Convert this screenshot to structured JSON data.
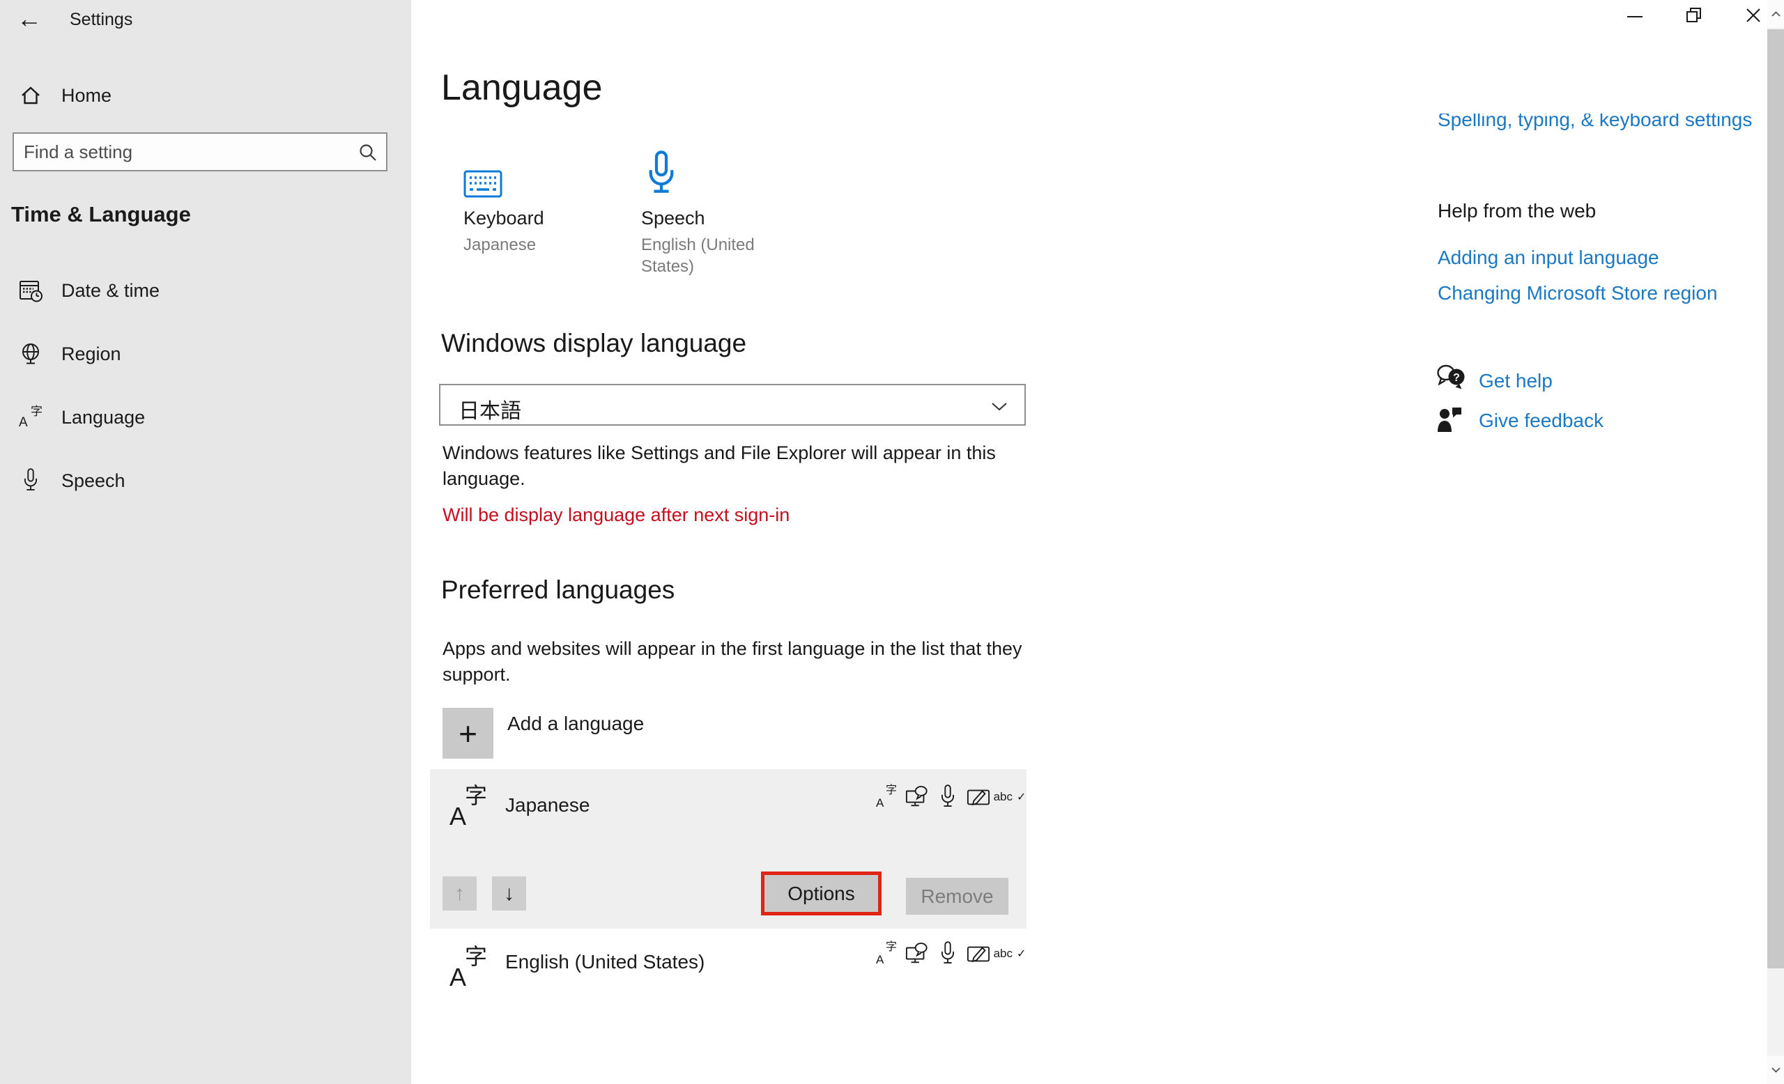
{
  "window": {
    "title": "Settings"
  },
  "titlebar": {
    "back_icon": "←"
  },
  "sidebar": {
    "home_label": "Home",
    "search": {
      "placeholder": "Find a setting"
    },
    "section_label": "Time & Language",
    "items": [
      {
        "label": "Date & time",
        "icon": "calendar-clock-icon"
      },
      {
        "label": "Region",
        "icon": "globe-icon"
      },
      {
        "label": "Language",
        "icon": "language-icon"
      },
      {
        "label": "Speech",
        "icon": "microphone-icon"
      }
    ]
  },
  "main": {
    "page_title": "Language",
    "tiles": [
      {
        "title": "Keyboard",
        "value": "Japanese",
        "icon": "keyboard-icon"
      },
      {
        "title": "Speech",
        "value": "English (United States)",
        "value_lines": [
          "English (United",
          "States)"
        ],
        "icon": "microphone-icon"
      }
    ],
    "display_language": {
      "heading": "Windows display language",
      "selected_value": "日本語",
      "description_lines": [
        "Windows features like Settings and File Explorer will appear in this",
        "language."
      ],
      "warning": "Will be display language after next sign-in"
    },
    "preferred_languages": {
      "heading": "Preferred languages",
      "description_lines": [
        "Apps and websites will appear in the first language in the list that they",
        "support."
      ],
      "add_button_label": "Add a language",
      "rows": [
        {
          "name": "Japanese",
          "selected": true
        },
        {
          "name": "English (United States)",
          "selected": false
        }
      ],
      "move_up_icon": "↑",
      "move_down_icon": "↓",
      "options_button_label": "Options",
      "remove_button_label": "Remove",
      "capability_icons": [
        "language-icon",
        "display-speech-icon",
        "microphone-icon",
        "handwriting-icon",
        "spellcheck-icon"
      ]
    }
  },
  "right_panel": {
    "clipped_link": "Spelling, typing, & keyboard settings",
    "help_heading": "Help from the web",
    "help_links": [
      "Adding an input language",
      "Changing Microsoft Store region"
    ],
    "get_help_label": "Get help",
    "give_feedback_label": "Give feedback"
  },
  "glyphs": {
    "language_icon_a": "A",
    "language_icon_kanji": "字",
    "spellcheck_text": "abc",
    "spellcheck_check": "✓",
    "add_plus": "+",
    "question_mark": "?"
  },
  "colors": {
    "accent_blue": "#0f7bd7",
    "link_blue": "#1b78c2",
    "warning_red": "#c50f1f",
    "highlight_red": "#e02416",
    "sidebar_gray": "#e7e7e7",
    "selected_row_gray": "#efefef",
    "button_gray": "#c9c9c9"
  }
}
